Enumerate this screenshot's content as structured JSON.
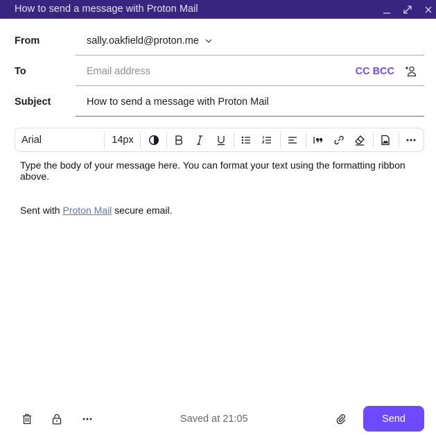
{
  "window": {
    "title": "How to send a message with Proton Mail",
    "controls": [
      "minimize",
      "maximize",
      "close"
    ]
  },
  "fields": {
    "from": {
      "label": "From",
      "value": "sally.oakfield@proton.me"
    },
    "to": {
      "label": "To",
      "value": "",
      "placeholder": "Email address",
      "cc_bcc_label": "CC BCC"
    },
    "subject": {
      "label": "Subject",
      "value": "How to send a message with Proton Mail"
    }
  },
  "toolbar": {
    "font_family": "Arial",
    "font_size": "14px",
    "buttons": [
      "text-color",
      "bold",
      "italic",
      "underline",
      "bulleted-list",
      "numbered-list",
      "align-left",
      "blockquote",
      "insert-link",
      "clear-formatting",
      "insert-image",
      "more"
    ]
  },
  "body": {
    "paragraph": "Type the body of your message here. You can format your text using the formatting ribbon above.",
    "signature_prefix": "Sent with ",
    "signature_link": "Proton Mail",
    "signature_suffix": " secure email."
  },
  "footer": {
    "saved_status": "Saved at 21:05",
    "send_label": "Send"
  },
  "colors": {
    "titlebar": "#372580",
    "accent": "#6d4aff",
    "link": "#5a72d9"
  }
}
